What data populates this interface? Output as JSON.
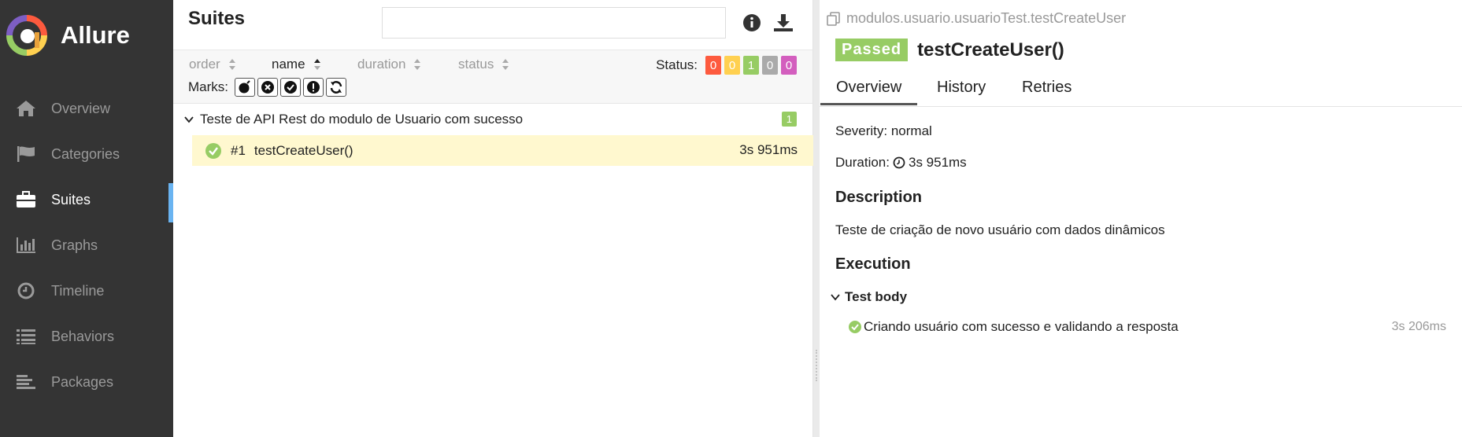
{
  "brand": {
    "name": "Allure"
  },
  "sidebar": {
    "items": [
      {
        "label": "Overview",
        "icon": "home-icon"
      },
      {
        "label": "Categories",
        "icon": "flag-icon"
      },
      {
        "label": "Suites",
        "icon": "briefcase-icon",
        "active": true
      },
      {
        "label": "Graphs",
        "icon": "bar-chart-icon"
      },
      {
        "label": "Timeline",
        "icon": "clock-icon"
      },
      {
        "label": "Behaviors",
        "icon": "list-icon"
      },
      {
        "label": "Packages",
        "icon": "align-left-icon"
      }
    ]
  },
  "suites": {
    "title": "Suites",
    "search": {
      "placeholder": "",
      "value": ""
    },
    "sort": {
      "order": "order",
      "name": "name",
      "duration": "duration",
      "status": "status",
      "active": "name"
    },
    "status_label": "Status:",
    "status_counts": [
      {
        "value": "0",
        "color": "#fd5a3e",
        "name": "failed"
      },
      {
        "value": "0",
        "color": "#ffd050",
        "name": "broken"
      },
      {
        "value": "1",
        "color": "#97cc64",
        "name": "passed"
      },
      {
        "value": "0",
        "color": "#aaaaaa",
        "name": "skipped"
      },
      {
        "value": "0",
        "color": "#d35ebe",
        "name": "unknown"
      }
    ],
    "marks_label": "Marks:",
    "marks": [
      "flaky-icon",
      "new-failed-icon",
      "new-passed-icon",
      "new-broken-icon",
      "retries-icon"
    ],
    "group": {
      "title": "Teste de API Rest do modulo de Usuario com sucesso",
      "count": "1"
    },
    "test": {
      "number": "#1",
      "name": "testCreateUser()",
      "duration": "3s 951ms"
    }
  },
  "detail": {
    "path": "modulos.usuario.usuarioTest.testCreateUser",
    "status": "Passed",
    "title": "testCreateUser()",
    "tabs": [
      "Overview",
      "History",
      "Retries"
    ],
    "severity": "Severity: normal",
    "duration_label": "Duration:",
    "duration": "3s 951ms",
    "description_title": "Description",
    "description": "Teste de criação de novo usuário com dados dinâmicos",
    "execution_title": "Execution",
    "test_body_label": "Test body",
    "step": {
      "name": "Criando usuário com sucesso e validando a resposta",
      "duration": "3s 206ms"
    }
  },
  "colors": {
    "sidebar": "#343434",
    "accent": "#6ab4f1",
    "passed": "#97cc64",
    "selected_row": "#fff8cf"
  }
}
